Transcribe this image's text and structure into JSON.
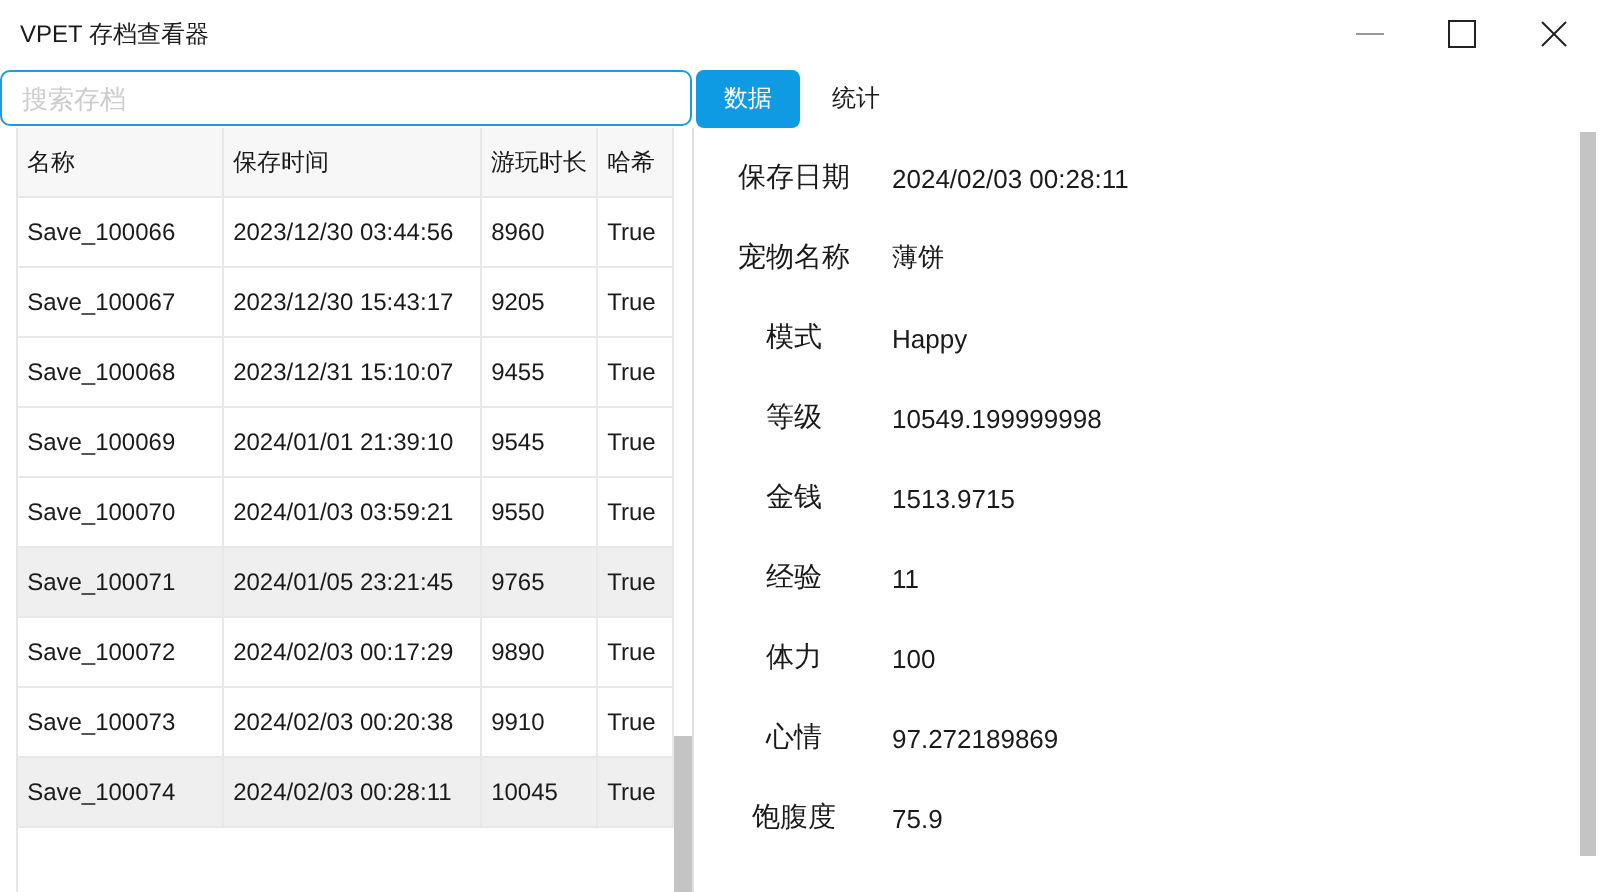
{
  "window": {
    "title": "VPET 存档查看器"
  },
  "search": {
    "placeholder": "搜索存档"
  },
  "tabs": [
    {
      "label": "数据",
      "selected": true
    },
    {
      "label": "统计",
      "selected": false
    }
  ],
  "table": {
    "columns": [
      "名称",
      "保存时间",
      "游玩时长",
      "哈希"
    ],
    "rows": [
      {
        "cells": [
          "Save_100066",
          "2023/12/30 03:44:56",
          "8960",
          "True"
        ],
        "selected": false
      },
      {
        "cells": [
          "Save_100067",
          "2023/12/30 15:43:17",
          "9205",
          "True"
        ],
        "selected": false
      },
      {
        "cells": [
          "Save_100068",
          "2023/12/31 15:10:07",
          "9455",
          "True"
        ],
        "selected": false
      },
      {
        "cells": [
          "Save_100069",
          "2024/01/01 21:39:10",
          "9545",
          "True"
        ],
        "selected": false
      },
      {
        "cells": [
          "Save_100070",
          "2024/01/03 03:59:21",
          "9550",
          "True"
        ],
        "selected": false
      },
      {
        "cells": [
          "Save_100071",
          "2024/01/05 23:21:45",
          "9765",
          "True"
        ],
        "selected": true
      },
      {
        "cells": [
          "Save_100072",
          "2024/02/03 00:17:29",
          "9890",
          "True"
        ],
        "selected": false
      },
      {
        "cells": [
          "Save_100073",
          "2024/02/03 00:20:38",
          "9910",
          "True"
        ],
        "selected": false
      },
      {
        "cells": [
          "Save_100074",
          "2024/02/03 00:28:11",
          "10045",
          "True"
        ],
        "selected": true
      }
    ]
  },
  "details": [
    {
      "label": "保存日期",
      "value": "2024/02/03 00:28:11"
    },
    {
      "label": "宠物名称",
      "value": "薄饼"
    },
    {
      "label": "模式",
      "value": "Happy"
    },
    {
      "label": "等级",
      "value": "10549.199999998"
    },
    {
      "label": "金钱",
      "value": "1513.9715"
    },
    {
      "label": "经验",
      "value": "11"
    },
    {
      "label": "体力",
      "value": "100"
    },
    {
      "label": "心情",
      "value": "97.272189869"
    },
    {
      "label": "饱腹度",
      "value": "75.9"
    }
  ]
}
